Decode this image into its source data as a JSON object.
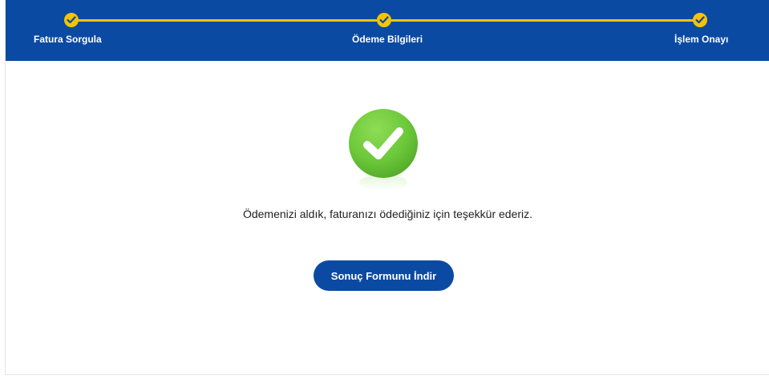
{
  "stepper": {
    "steps": [
      {
        "label": "Fatura Sorgula",
        "status": "completed",
        "icon": "check-icon"
      },
      {
        "label": "Ödeme Bilgileri",
        "status": "completed",
        "icon": "check-icon"
      },
      {
        "label": "İşlem Onayı",
        "status": "completed",
        "icon": "check-icon"
      }
    ]
  },
  "result": {
    "icon": "success-check-icon",
    "message": "Ödemenizi aldık, faturanızı ödediğiniz için teşekkür ederiz.",
    "download_label": "Sonuç Formunu İndir"
  },
  "colors": {
    "header_bg": "#0b4aa2",
    "step_accent": "#f5c400",
    "success_green": "#6cc83a",
    "button_bg": "#0b4aa2"
  }
}
